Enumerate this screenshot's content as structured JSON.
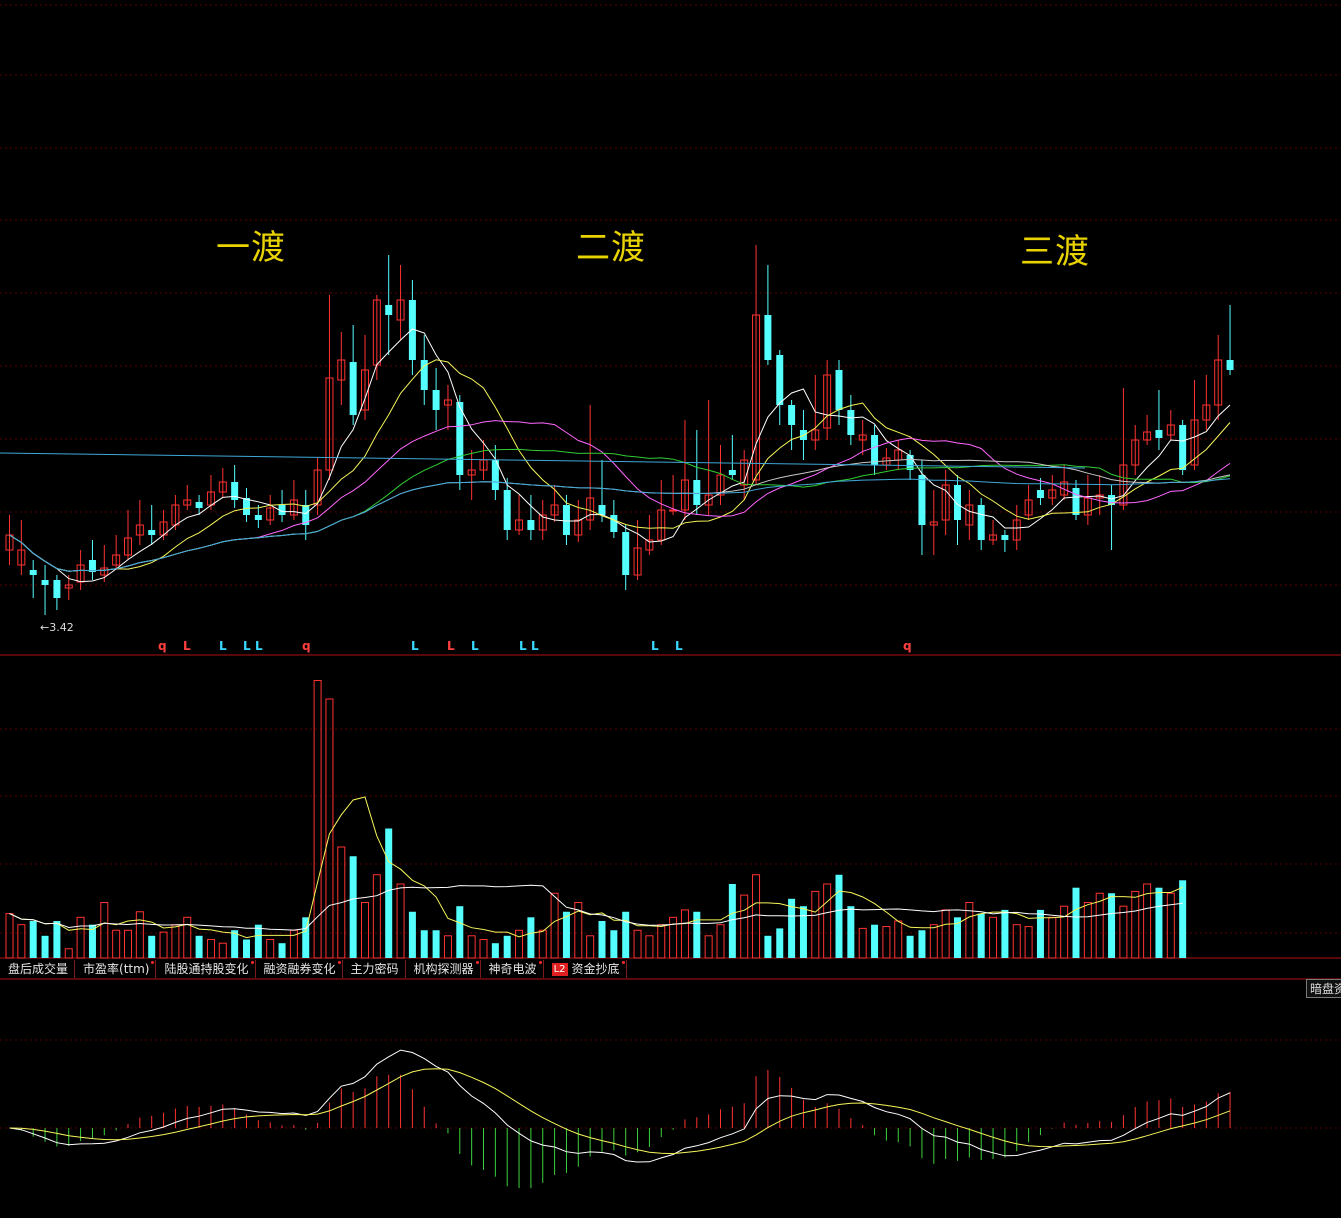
{
  "wave_labels": [
    "一渡",
    "二渡",
    "三渡"
  ],
  "low_marker": "3.42",
  "signals": [
    {
      "t": "q",
      "c": "#ff4040"
    },
    {
      "t": "L",
      "c": "#ff4040"
    },
    {
      "t": "L",
      "c": "#3ad8ff"
    },
    {
      "t": "L",
      "c": "#3ad8ff"
    },
    {
      "t": "L",
      "c": "#3ad8ff"
    },
    {
      "t": "q",
      "c": "#ff4040"
    },
    {
      "t": "L",
      "c": "#3ad8ff"
    },
    {
      "t": "L",
      "c": "#ff4040"
    },
    {
      "t": "L",
      "c": "#3ad8ff"
    },
    {
      "t": "L",
      "c": "#3ad8ff"
    },
    {
      "t": "L",
      "c": "#3ad8ff"
    },
    {
      "t": "L",
      "c": "#3ad8ff"
    },
    {
      "t": "L",
      "c": "#3ad8ff"
    },
    {
      "t": "q",
      "c": "#ff4040"
    }
  ],
  "tabs": [
    {
      "label": "盘后成交量",
      "dot": false
    },
    {
      "label": "市盈率(ttm)",
      "dot": true
    },
    {
      "label": "陆股通持股变化",
      "dot": true
    },
    {
      "label": "融资融券变化",
      "dot": true
    },
    {
      "label": "主力密码",
      "dot": false
    },
    {
      "label": "机构探测器",
      "dot": true
    },
    {
      "label": "神奇电波",
      "dot": true
    },
    {
      "label": "资金抄底",
      "dot": true,
      "badge": "L2"
    }
  ],
  "dark_button": "暗盘资",
  "colors": {
    "up": "#ff3232",
    "down": "#54ffff",
    "grid": "#5a0000",
    "label": "#e8d200",
    "divider": "#b01010"
  },
  "chart_data": {
    "type": "candlestick",
    "title": "",
    "xlabel": "",
    "ylabel": "",
    "candles": [
      [
        4.1,
        4.25,
        4.45,
        3.95
      ],
      [
        3.95,
        4.1,
        4.4,
        3.85
      ],
      [
        3.9,
        3.85,
        4.0,
        3.62
      ],
      [
        3.8,
        3.75,
        3.95,
        3.45
      ],
      [
        3.8,
        3.62,
        3.85,
        3.5
      ],
      [
        3.72,
        3.75,
        3.85,
        3.6
      ],
      [
        3.78,
        3.95,
        4.1,
        3.7
      ],
      [
        4.0,
        3.88,
        4.2,
        3.8
      ],
      [
        3.85,
        3.92,
        4.15,
        3.78
      ],
      [
        3.95,
        4.05,
        4.25,
        3.9
      ],
      [
        4.05,
        4.22,
        4.5,
        4.0
      ],
      [
        4.25,
        4.35,
        4.6,
        4.15
      ],
      [
        4.3,
        4.25,
        4.55,
        4.15
      ],
      [
        4.25,
        4.38,
        4.5,
        4.2
      ],
      [
        4.35,
        4.55,
        4.65,
        4.3
      ],
      [
        4.55,
        4.6,
        4.75,
        4.5
      ],
      [
        4.58,
        4.52,
        4.65,
        4.45
      ],
      [
        4.55,
        4.68,
        4.85,
        4.5
      ],
      [
        4.68,
        4.78,
        4.92,
        4.62
      ],
      [
        4.78,
        4.6,
        4.95,
        4.52
      ],
      [
        4.62,
        4.45,
        4.72,
        4.38
      ],
      [
        4.45,
        4.4,
        4.55,
        4.32
      ],
      [
        4.4,
        4.52,
        4.65,
        4.35
      ],
      [
        4.55,
        4.45,
        4.7,
        4.38
      ],
      [
        4.45,
        4.6,
        4.8,
        4.4
      ],
      [
        4.55,
        4.35,
        4.7,
        4.2
      ],
      [
        4.55,
        4.9,
        5.02,
        4.45
      ],
      [
        4.9,
        5.82,
        6.65,
        4.8
      ],
      [
        5.8,
        6.0,
        6.28,
        5.55
      ],
      [
        5.98,
        5.45,
        6.35,
        5.35
      ],
      [
        5.5,
        5.9,
        6.25,
        5.4
      ],
      [
        5.95,
        6.6,
        6.65,
        5.8
      ],
      [
        6.55,
        6.45,
        7.05,
        6.05
      ],
      [
        6.4,
        6.6,
        6.95,
        6.2
      ],
      [
        6.6,
        6.0,
        6.8,
        5.85
      ],
      [
        6.0,
        5.7,
        6.25,
        5.55
      ],
      [
        5.7,
        5.5,
        5.92,
        5.3
      ],
      [
        5.55,
        5.6,
        5.75,
        5.3
      ],
      [
        5.58,
        4.85,
        5.65,
        4.7
      ],
      [
        4.85,
        4.9,
        5.1,
        4.6
      ],
      [
        4.9,
        5.0,
        5.2,
        4.8
      ],
      [
        5.0,
        4.7,
        5.15,
        4.6
      ],
      [
        4.7,
        4.3,
        4.82,
        4.2
      ],
      [
        4.3,
        4.4,
        4.65,
        4.25
      ],
      [
        4.4,
        4.3,
        4.65,
        4.2
      ],
      [
        4.3,
        4.45,
        4.6,
        4.2
      ],
      [
        4.45,
        4.55,
        4.75,
        4.38
      ],
      [
        4.55,
        4.25,
        4.65,
        4.15
      ],
      [
        4.25,
        4.4,
        4.6,
        4.18
      ],
      [
        4.4,
        4.62,
        5.55,
        4.3
      ],
      [
        4.55,
        4.45,
        5.0,
        4.38
      ],
      [
        4.45,
        4.28,
        4.6,
        4.22
      ],
      [
        4.28,
        3.85,
        4.35,
        3.7
      ],
      [
        3.85,
        4.12,
        4.4,
        3.8
      ],
      [
        4.1,
        4.2,
        4.45,
        4.05
      ],
      [
        4.2,
        4.5,
        4.8,
        4.15
      ],
      [
        4.5,
        4.5,
        4.85,
        4.45
      ],
      [
        4.5,
        4.8,
        5.4,
        4.4
      ],
      [
        4.8,
        4.55,
        5.3,
        4.45
      ],
      [
        4.55,
        4.65,
        5.6,
        4.45
      ],
      [
        4.65,
        4.85,
        5.15,
        4.55
      ],
      [
        4.9,
        4.85,
        5.25,
        4.8
      ],
      [
        4.75,
        5.0,
        5.1,
        4.6
      ],
      [
        4.8,
        6.45,
        7.15,
        4.75
      ],
      [
        6.45,
        6.0,
        6.95,
        5.95
      ],
      [
        6.05,
        5.55,
        6.1,
        5.35
      ],
      [
        5.55,
        5.35,
        5.6,
        5.1
      ],
      [
        5.3,
        5.2,
        5.5,
        5.0
      ],
      [
        5.2,
        5.3,
        5.85,
        5.1
      ],
      [
        5.32,
        5.85,
        6.0,
        5.2
      ],
      [
        5.9,
        5.5,
        6.0,
        5.35
      ],
      [
        5.5,
        5.25,
        5.65,
        5.15
      ],
      [
        5.2,
        5.25,
        5.4,
        5.05
      ],
      [
        5.25,
        4.95,
        5.35,
        4.85
      ],
      [
        4.95,
        5.02,
        5.12,
        4.9
      ],
      [
        5.0,
        5.1,
        5.2,
        4.9
      ],
      [
        5.05,
        4.9,
        5.1,
        4.8
      ],
      [
        4.85,
        4.35,
        5.0,
        4.05
      ],
      [
        4.35,
        4.38,
        4.7,
        4.05
      ],
      [
        4.4,
        4.75,
        4.9,
        4.25
      ],
      [
        4.75,
        4.4,
        4.85,
        4.15
      ],
      [
        4.35,
        4.55,
        4.7,
        4.2
      ],
      [
        4.55,
        4.2,
        4.62,
        4.1
      ],
      [
        4.2,
        4.25,
        4.4,
        4.15
      ],
      [
        4.25,
        4.2,
        4.3,
        4.08
      ],
      [
        4.2,
        4.4,
        4.55,
        4.1
      ],
      [
        4.45,
        4.6,
        4.75,
        4.4
      ],
      [
        4.7,
        4.62,
        4.82,
        4.55
      ],
      [
        4.62,
        4.7,
        4.85,
        4.55
      ],
      [
        4.65,
        4.78,
        4.95,
        4.6
      ],
      [
        4.72,
        4.45,
        4.8,
        4.4
      ],
      [
        4.45,
        4.62,
        4.85,
        4.35
      ],
      [
        4.62,
        4.65,
        4.85,
        4.45
      ],
      [
        4.65,
        4.55,
        4.75,
        4.1
      ],
      [
        4.55,
        4.95,
        5.72,
        4.5
      ],
      [
        4.95,
        5.2,
        5.35,
        4.85
      ],
      [
        5.2,
        5.28,
        5.45,
        5.15
      ],
      [
        5.3,
        5.22,
        5.7,
        5.1
      ],
      [
        5.25,
        5.35,
        5.5,
        5.2
      ],
      [
        5.35,
        4.9,
        5.4,
        4.85
      ],
      [
        4.95,
        5.4,
        5.8,
        4.9
      ],
      [
        5.4,
        5.55,
        5.85,
        5.3
      ],
      [
        5.55,
        6.0,
        6.25,
        5.4
      ],
      [
        6.0,
        5.9,
        6.55,
        5.85
      ]
    ],
    "volume": [
      24,
      18,
      20,
      12,
      20,
      5,
      22,
      18,
      30,
      15,
      15,
      25,
      12,
      14,
      18,
      22,
      12,
      10,
      8,
      15,
      10,
      18,
      10,
      8,
      15,
      22,
      150,
      140,
      60,
      55,
      30,
      45,
      70,
      40,
      25,
      15,
      15,
      12,
      28,
      12,
      10,
      8,
      12,
      15,
      22,
      15,
      35,
      25,
      30,
      12,
      20,
      15,
      25,
      15,
      12,
      18,
      22,
      26,
      25,
      12,
      18,
      40,
      34,
      45,
      12,
      16,
      32,
      28,
      36,
      40,
      45,
      28,
      16,
      18,
      17,
      20,
      12,
      15,
      18,
      26,
      22,
      30,
      24,
      22,
      26,
      18,
      17,
      26,
      22,
      28,
      38,
      30,
      35,
      35,
      28,
      36,
      40,
      38,
      35,
      42
    ],
    "oscillator_hist": [
      -0.45,
      -0.48,
      -0.5,
      -0.52,
      -0.5,
      -0.4,
      -0.3,
      -0.22,
      -0.15,
      0.05,
      0.1,
      0.12,
      0.14,
      0.16,
      0.18,
      0.2,
      0.24,
      0.26,
      0.28,
      0.3
    ]
  }
}
